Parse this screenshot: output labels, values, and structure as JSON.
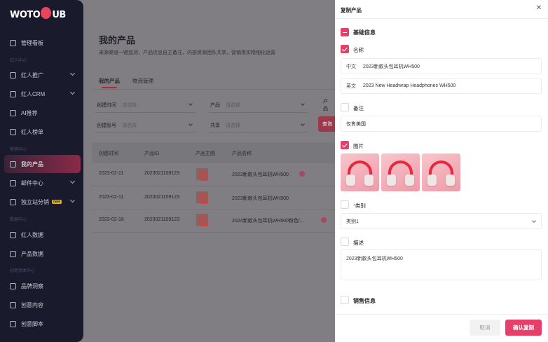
{
  "logo": {
    "text_a": "WOTO",
    "text_b": "UB"
  },
  "sidebar": {
    "items": [
      {
        "label": "管理看板",
        "icon": "dashboard-icon"
      },
      {
        "label": "红人推广",
        "icon": "user-icon"
      },
      {
        "label": "红人CRM",
        "icon": "user-icon"
      },
      {
        "label": "AI推荐",
        "icon": "ai-icon"
      },
      {
        "label": "红人榜单",
        "icon": "trophy-icon"
      },
      {
        "label": "我的产品",
        "icon": "box-icon"
      },
      {
        "label": "邮件中心",
        "icon": "mail-icon"
      },
      {
        "label": "独立站分销",
        "icon": "shop-icon",
        "badge": "new"
      },
      {
        "label": "红人数据",
        "icon": "data-icon"
      },
      {
        "label": "产品数据",
        "icon": "chart-icon"
      },
      {
        "label": "品牌洞察",
        "icon": "diamond-icon"
      },
      {
        "label": "创意内容",
        "icon": "bulb-icon"
      },
      {
        "label": "创意脚本",
        "icon": "script-icon"
      }
    ],
    "sections": [
      "红人中心",
      "营销中心",
      "数据中心",
      "创意资本中心"
    ]
  },
  "main": {
    "title": "我的产品",
    "desc": "来源渠道一键监测，产品信息自主备注，内部资源团队共享，营销落实精细化运营",
    "tabs": [
      "我的产品",
      "物流管理"
    ],
    "filters": {
      "create_time": "创建时间",
      "create_time_ph": "请选择",
      "product": "产品",
      "product_ph": "请选择",
      "product2": "产品",
      "account": "创建账号",
      "account_ph": "请选择",
      "share": "共享",
      "share_ph": "请选择",
      "query_btn": "查询"
    },
    "table": {
      "headers": [
        "创建时间",
        "产品ID",
        "产品主图",
        "产品名称"
      ],
      "rows": [
        {
          "date": "2023-02-11",
          "id": "2023021109123",
          "name": "2023新款头包耳机WH500"
        },
        {
          "date": "2023-02-11",
          "id": "2023021109123",
          "name": "2023新款头包耳机WH500"
        },
        {
          "date": "2023-02-18",
          "id": "2023021109123",
          "name": "2024新款头包耳机WH500粉色/..."
        }
      ]
    }
  },
  "drawer": {
    "title": "复制产品",
    "basic_info": "基础信息",
    "name_label": "名称",
    "name_cn_prefix": "中文",
    "name_cn": "2023新款头包耳机WH500",
    "name_en_prefix": "英文",
    "name_en": "2023 New Headwrap Headphones WH500",
    "remark_label": "备注",
    "remark_value": "仅售美国",
    "image_label": "图片",
    "category_label": "类别",
    "category_required": "*",
    "category_value": "类别1",
    "desc_label": "描述",
    "desc_value": "2023新款头包耳机WH500",
    "sales_label": "销售信息",
    "cancel": "取消",
    "confirm": "确认复制"
  }
}
